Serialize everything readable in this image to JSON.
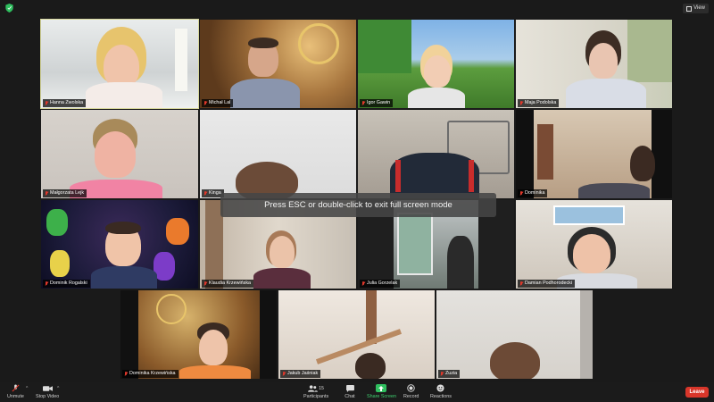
{
  "top_bar": {
    "view_label": "View"
  },
  "participants": [
    {
      "name": "Hanna Zwolska"
    },
    {
      "name": "Michał Lal"
    },
    {
      "name": "Igor Gawin"
    },
    {
      "name": "Maja Podolska"
    },
    {
      "name": "Małgorzata Lejk"
    },
    {
      "name": "Kinga"
    },
    {
      "name": ""
    },
    {
      "name": "Dominika"
    },
    {
      "name": "Dominik Rogalski"
    },
    {
      "name": "Klaudia Krzewińska"
    },
    {
      "name": "Julia Gorzelak"
    },
    {
      "name": "Damian Podhorodecki"
    },
    {
      "name": "Dominika Krzewińska"
    },
    {
      "name": "Jakub Jaśniak"
    },
    {
      "name": "Zuzia"
    }
  ],
  "overlay": {
    "message": "Press ESC or double-click to exit full screen mode"
  },
  "toolbar": {
    "unmute_label": "Unmute",
    "stop_video_label": "Stop Video",
    "participants_label": "Participants",
    "participants_count": "15",
    "chat_label": "Chat",
    "share_label": "Share Screen",
    "record_label": "Record",
    "reactions_label": "Reactions",
    "leave_label": "Leave"
  },
  "colors": {
    "leave": "#d8362a",
    "share": "#2fbf5f",
    "active_speaker_border": "#d7d79a",
    "muted_mic": "#e0382b"
  }
}
